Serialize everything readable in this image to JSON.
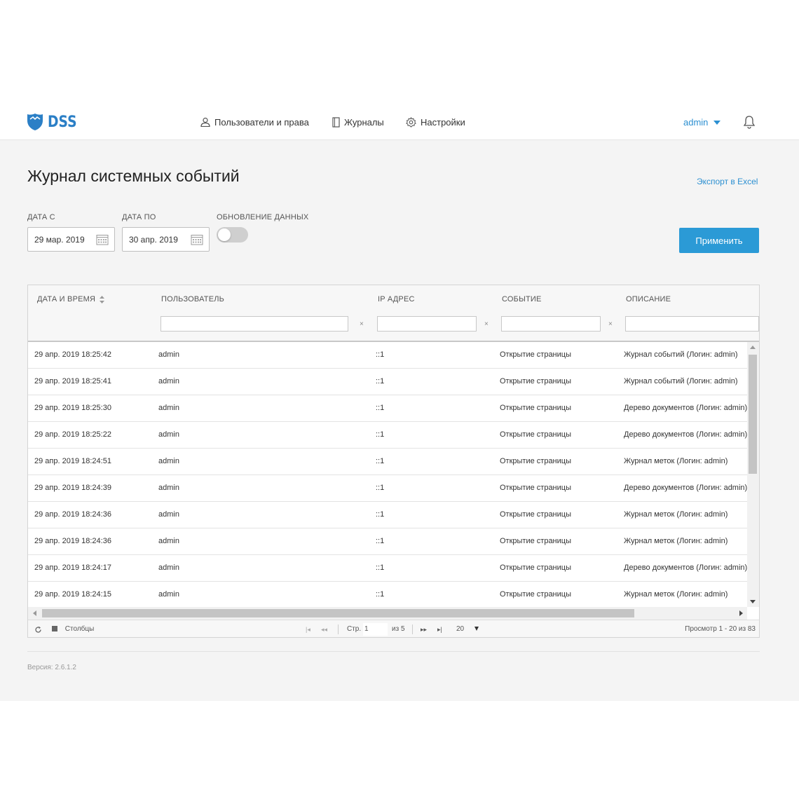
{
  "header": {
    "logo_text": "DSS",
    "nav": [
      {
        "label": "Пользователи и права",
        "icon": "user-icon"
      },
      {
        "label": "Журналы",
        "icon": "journal-icon"
      },
      {
        "label": "Настройки",
        "icon": "gear-icon"
      }
    ],
    "user": "admin",
    "notifications_icon": "bell-icon"
  },
  "page": {
    "title": "Журнал системных событий",
    "export_label": "Экспорт в Excel"
  },
  "filters": {
    "date_from_label": "ДАТА С",
    "date_from_value": "29 мар. 2019",
    "date_to_label": "ДАТА ПО",
    "date_to_value": "30 апр. 2019",
    "refresh_label": "ОБНОВЛЕНИЕ ДАННЫХ",
    "refresh_enabled": false,
    "apply_label": "Применить"
  },
  "table": {
    "columns": [
      "ДАТА И ВРЕМЯ",
      "ПОЛЬЗОВАТЕЛЬ",
      "IP АДРЕС",
      "СОБЫТИЕ",
      "ОПИСАНИЕ"
    ],
    "clear_glyph": "×",
    "rows": [
      [
        "29 апр. 2019 18:25:42",
        "admin",
        "::1",
        "Открытие страницы",
        "Журнал событий (Логин: admin)"
      ],
      [
        "29 апр. 2019 18:25:41",
        "admin",
        "::1",
        "Открытие страницы",
        "Журнал событий (Логин: admin)"
      ],
      [
        "29 апр. 2019 18:25:30",
        "admin",
        "::1",
        "Открытие страницы",
        "Дерево документов (Логин: admin)"
      ],
      [
        "29 апр. 2019 18:25:22",
        "admin",
        "::1",
        "Открытие страницы",
        "Дерево документов (Логин: admin)"
      ],
      [
        "29 апр. 2019 18:24:51",
        "admin",
        "::1",
        "Открытие страницы",
        "Журнал меток (Логин: admin)"
      ],
      [
        "29 апр. 2019 18:24:39",
        "admin",
        "::1",
        "Открытие страницы",
        "Дерево документов (Логин: admin)"
      ],
      [
        "29 апр. 2019 18:24:36",
        "admin",
        "::1",
        "Открытие страницы",
        "Журнал меток (Логин: admin)"
      ],
      [
        "29 апр. 2019 18:24:36",
        "admin",
        "::1",
        "Открытие страницы",
        "Журнал меток (Логин: admin)"
      ],
      [
        "29 апр. 2019 18:24:17",
        "admin",
        "::1",
        "Открытие страницы",
        "Дерево документов (Логин: admin)"
      ],
      [
        "29 апр. 2019 18:24:15",
        "admin",
        "::1",
        "Открытие страницы",
        "Журнал меток (Логин: admin)"
      ]
    ]
  },
  "pager": {
    "columns_label": "Столбцы",
    "page_label": "Стр.",
    "page_value": "1",
    "of_label": "из 5",
    "page_size": "20",
    "summary": "Просмотр 1 - 20 из 83"
  },
  "footer": {
    "version": "Версия: 2.6.1.2"
  },
  "colors": {
    "accent": "#2b9ad6",
    "link": "#2b8fd1",
    "logo": "#2b7fc6"
  }
}
